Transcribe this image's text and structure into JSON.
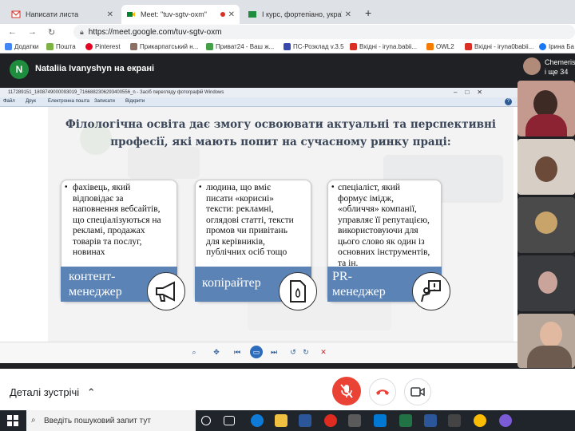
{
  "browser": {
    "tabs": [
      {
        "label": "Написати листа",
        "active": false
      },
      {
        "label": "Meet: \"tuv-sgtv-oxm\"",
        "active": true
      },
      {
        "label": "І курс, фортепіано, українська",
        "active": false
      }
    ],
    "new_tab_symbol": "+",
    "url": "https://meet.google.com/tuv-sgtv-oxm",
    "bookmarks": [
      {
        "label": "Додатки",
        "color": "#4285f4"
      },
      {
        "label": "Пошта",
        "color": "#7cb342"
      },
      {
        "label": "Pinterest",
        "color": "#e60023"
      },
      {
        "label": "Прикарпатський н...",
        "color": "#8d6e63"
      },
      {
        "label": "Приват24 - Ваш ж...",
        "color": "#43a047"
      },
      {
        "label": "ПС-Розклад v.3.5",
        "color": "#3949ab"
      },
      {
        "label": "Вхідні - iryna.babii...",
        "color": "#d93025"
      },
      {
        "label": "OWL2",
        "color": "#f57c00"
      },
      {
        "label": "Вхідні - iryna0babii...",
        "color": "#d93025"
      },
      {
        "label": "Ірина Ба",
        "color": "#1877f2"
      }
    ]
  },
  "meet": {
    "presenter_initial": "N",
    "presenter_label": "Nataliia Ivanyshyn на екрані",
    "participants": {
      "name": "Chemeris",
      "more": "і ще 34"
    },
    "details_label": "Деталі зустрічі",
    "controls": {
      "mic": "mic-off-icon",
      "hangup": "hangup-icon",
      "camera": "camera-icon"
    },
    "colors": {
      "mic_off": "#ea4335",
      "accent": "#1a73e8"
    }
  },
  "viewer": {
    "title": "117289151_1808749000093019_7166882306293400556_n - Засіб перегляду фотографій Windows",
    "menu": [
      "Файл",
      "Друк",
      "Електронна пошта",
      "Записати",
      "Відкрити"
    ]
  },
  "slide": {
    "heading_line1": "Філологічна освіта дає змогу освоювати актуальні та перспективні",
    "heading_line2": "професії, які мають попит на сучасному ринку праці:",
    "cards": [
      {
        "lines": [
          "фахівець, який",
          "відповідає за",
          "наповнення вебсайтів,",
          "що спеціалізуються на",
          "рекламі, продажах",
          "товарів та послуг,",
          "новинах"
        ],
        "role_lines": [
          "контент-",
          "менеджер"
        ],
        "icon": "megaphone-icon"
      },
      {
        "lines": [
          "людина, що вміє",
          "писати «корисні»",
          "тексти: рекламні,",
          "оглядові статті, тексти",
          "промов чи привітань",
          "для керівників,",
          "публічних осіб тощо"
        ],
        "role_lines": [
          "копірайтер"
        ],
        "icon": "document-icon"
      },
      {
        "lines": [
          "спеціаліст, який",
          "формує імідж,",
          "«обличчя» компанії,",
          "управляє її репутацією,",
          "використовуючи для",
          "цього слово як один із",
          "основних інструментів,",
          "та ін."
        ],
        "role_lines": [
          "PR-",
          "менеджер"
        ],
        "icon": "speaker-sign-icon"
      }
    ]
  },
  "taskbar": {
    "search_placeholder": "Введіть пошуковий запит тут"
  }
}
